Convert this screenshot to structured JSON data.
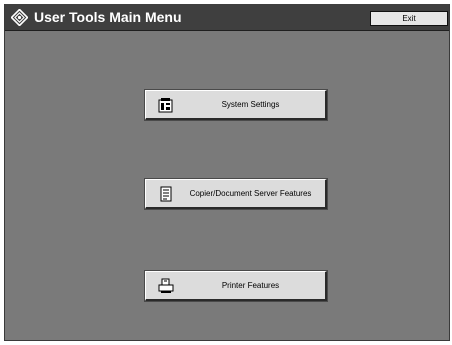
{
  "header": {
    "title": "User Tools Main Menu",
    "exit_label": "Exit"
  },
  "menu": {
    "items": [
      {
        "label": "System Settings",
        "icon": "settings-icon"
      },
      {
        "label": "Copier/Document Server Features",
        "icon": "copier-icon"
      },
      {
        "label": "Printer Features",
        "icon": "printer-icon"
      }
    ]
  },
  "colors": {
    "background": "#7a7a7a",
    "titlebar": "#3f3f3f",
    "button": "#dcdcdc"
  }
}
